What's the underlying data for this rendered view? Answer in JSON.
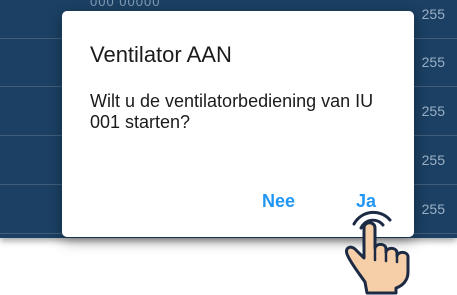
{
  "background_list": {
    "top_text": "000 00000",
    "values": [
      "255",
      "255",
      "255",
      "255",
      "255"
    ]
  },
  "dialog": {
    "title": "Ventilator AAN",
    "message": "Wilt u de ventilatorbediening van IU 001 starten?",
    "no_label": "Nee",
    "yes_label": "Ja"
  },
  "colors": {
    "list_background": "#1e466c",
    "button_text": "#2196f3",
    "hand_fill": "#f6cfa8",
    "hand_outline": "#1c2a44"
  },
  "icons": {
    "pointer": "tapping-hand-icon"
  }
}
